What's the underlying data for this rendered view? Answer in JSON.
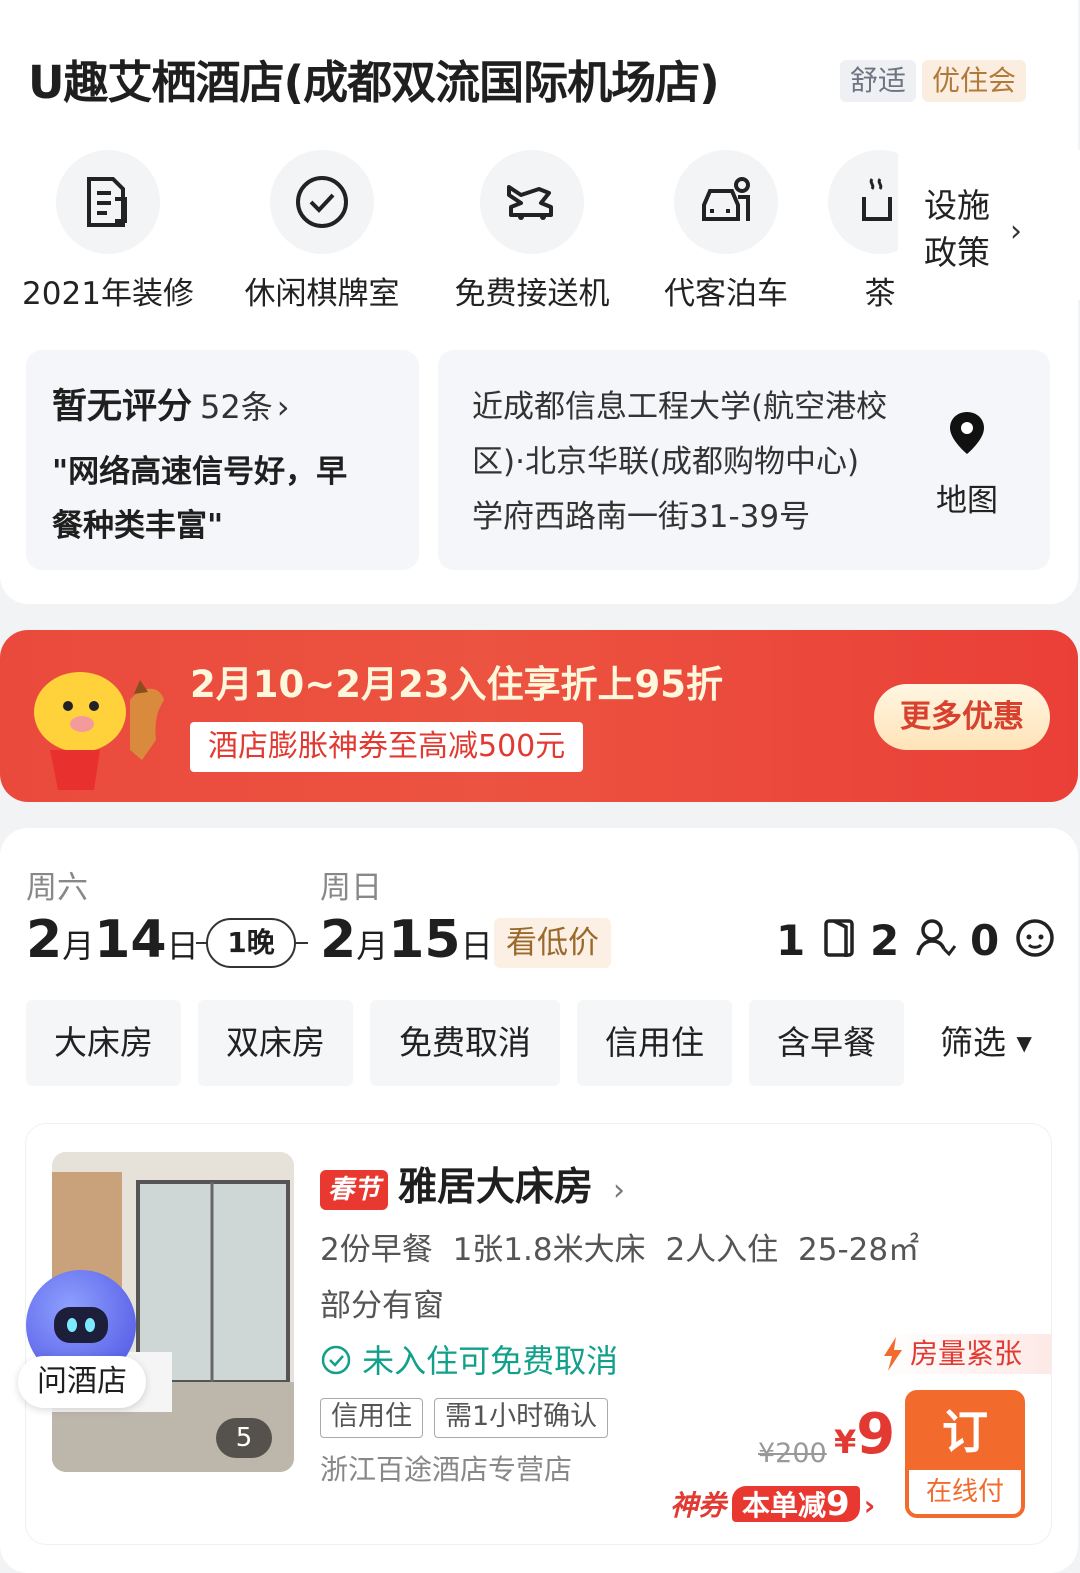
{
  "hotel": {
    "name": "U趣艾栖酒店(成都双流国际机场店)",
    "tags": [
      "舒适",
      "优住会"
    ]
  },
  "facilities": [
    {
      "label": "2021年装修",
      "icon": "document-icon"
    },
    {
      "label": "休闲棋牌室",
      "icon": "check-circle-icon"
    },
    {
      "label": "免费接送机",
      "icon": "car-plane-icon"
    },
    {
      "label": "代客泊车",
      "icon": "valet-parking-icon"
    },
    {
      "label": "茶",
      "icon": "tea-icon"
    }
  ],
  "policy": {
    "line1": "设施",
    "line2": "政策"
  },
  "review": {
    "score": "暂无评分",
    "count": "52条",
    "quote_line1": "\"网络高速信号好，早",
    "quote_line2": "餐种类丰富\""
  },
  "location": {
    "line1": "近成都信息工程大学(航空港校",
    "line2": "区)·北京华联(成都购物中心)",
    "line3": "学府西路南一街31-39号",
    "map_label": "地图"
  },
  "promo": {
    "headline": "2月10~2月23入住享折上95折",
    "sub": "酒店膨胀神券至高减500元",
    "more": "更多优惠"
  },
  "dates": {
    "checkin": {
      "weekday": "周六",
      "month": "2",
      "day": "14",
      "month_unit": "月",
      "day_unit": "日"
    },
    "checkout": {
      "weekday": "周日",
      "month": "2",
      "day": "15",
      "month_unit": "月",
      "day_unit": "日"
    },
    "nights": "1晚",
    "low_price": "看低价"
  },
  "occupancy": {
    "rooms": "1",
    "adults": "2",
    "children": "0"
  },
  "filters": [
    "大床房",
    "双床房",
    "免费取消",
    "信用住",
    "含早餐",
    "筛选"
  ],
  "room": {
    "badge": "春节",
    "name": "雅居大床房",
    "info": "2份早餐 1张1.8米大床 2人入住 25-28㎡",
    "window": "部分有窗",
    "cancel": "未入住可免费取消",
    "scarcity": "房量紧张",
    "tags": [
      "信用住",
      "需1小时确认"
    ],
    "store": "浙江百途酒店专营店",
    "orig_price": "¥200",
    "currency": "¥",
    "price": "9",
    "book": "订",
    "pay": "在线付",
    "coupon_label": "神券",
    "coupon_text": "本单减",
    "coupon_amount": "9",
    "photo_count": "5"
  },
  "assistant": {
    "label": "问酒店"
  },
  "colors": {
    "brand_red": "#e23a32",
    "orange": "#f36b2c",
    "teal": "#12a08a"
  }
}
